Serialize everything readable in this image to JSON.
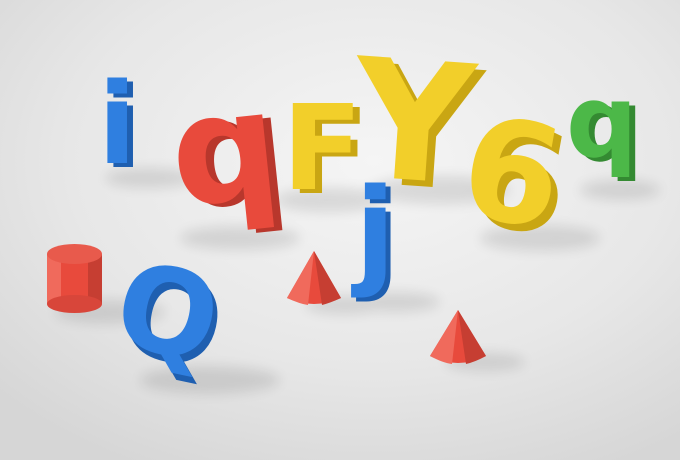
{
  "scene": {
    "background": "#e8e8e8",
    "colors": {
      "blue": "#2f7fe0",
      "blue_dark": "#1f5fb0",
      "red": "#e84a3c",
      "red_dark": "#b8372c",
      "yellow": "#f2cf2a",
      "yellow_dark": "#c9a613",
      "green": "#4cb848",
      "green_dark": "#348a32"
    },
    "letters": [
      {
        "id": "i",
        "char": "i",
        "color": "blue"
      },
      {
        "id": "q",
        "char": "q",
        "color": "red"
      },
      {
        "id": "F",
        "char": "F",
        "color": "yellow"
      },
      {
        "id": "Y",
        "char": "Y",
        "color": "yellow"
      },
      {
        "id": "6",
        "char": "6",
        "color": "yellow"
      },
      {
        "id": "q-small",
        "char": "q",
        "color": "green"
      },
      {
        "id": "j",
        "char": "j",
        "color": "blue"
      },
      {
        "id": "Q",
        "char": "Q",
        "color": "blue"
      }
    ],
    "shapes": [
      {
        "id": "cylinder",
        "kind": "cylinder",
        "color": "red"
      },
      {
        "id": "cone-left",
        "kind": "cone",
        "color": "red"
      },
      {
        "id": "cone-right",
        "kind": "cone",
        "color": "red"
      }
    ]
  }
}
